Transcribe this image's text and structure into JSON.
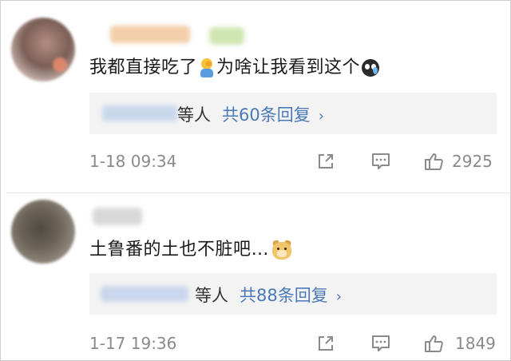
{
  "comments": [
    {
      "text_before": "我都直接吃了",
      "emoji1": "facepalm-emoji",
      "text_middle": "为啥让我看到这个",
      "emoji2": "sweat-emoji",
      "reply_others": "等人",
      "reply_count": "共60条回复",
      "reply_chevron": "›",
      "time": "1-18 09:34",
      "likes": "2925"
    },
    {
      "text": "土鲁番的土也不脏吧…",
      "emoji": "doge-emoji",
      "reply_others": "等人",
      "reply_count": "共88条回复",
      "reply_chevron": "›",
      "time": "1-17 19:36",
      "likes": "1849"
    }
  ],
  "icons": {
    "share": "share-icon",
    "comment": "comment-icon",
    "like": "thumbs-up-icon"
  },
  "colors": {
    "link": "#4a79b8",
    "muted": "#8a8a8a",
    "reply_bg": "#f3f3f3",
    "text": "#1a1a1a"
  }
}
